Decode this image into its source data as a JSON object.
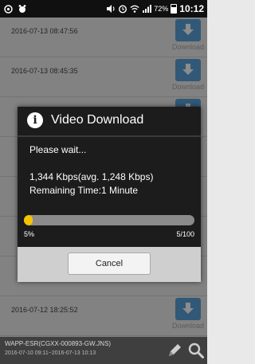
{
  "status_bar": {
    "battery_text": "72%",
    "time": "10:12"
  },
  "list": {
    "download_label": "Download",
    "rows": [
      {
        "date": "2016-07-13 08:47:56"
      },
      {
        "date": "2016-07-13 08:45:35"
      },
      {
        "date": "2016-07-12 18:25:52"
      }
    ]
  },
  "dialog": {
    "title": "Video Download",
    "wait_text": "Please wait...",
    "rate_text": "1,344 Kbps(avg. 1,248 Kbps)",
    "remaining_text": "Remaining Time:1 Minute",
    "progress": {
      "percent": 5,
      "percent_text": "5%",
      "count_text": "5/100",
      "color": "#f5c400"
    },
    "cancel_label": "Cancel"
  },
  "bottom_bar": {
    "device_name": "WAPP-ESR(CGXX-000893-GW.JNS)",
    "date_range": "2016-07-10 09:11~2016-07-13 10:13"
  },
  "colors": {
    "download_button": "#5aa3d9"
  }
}
